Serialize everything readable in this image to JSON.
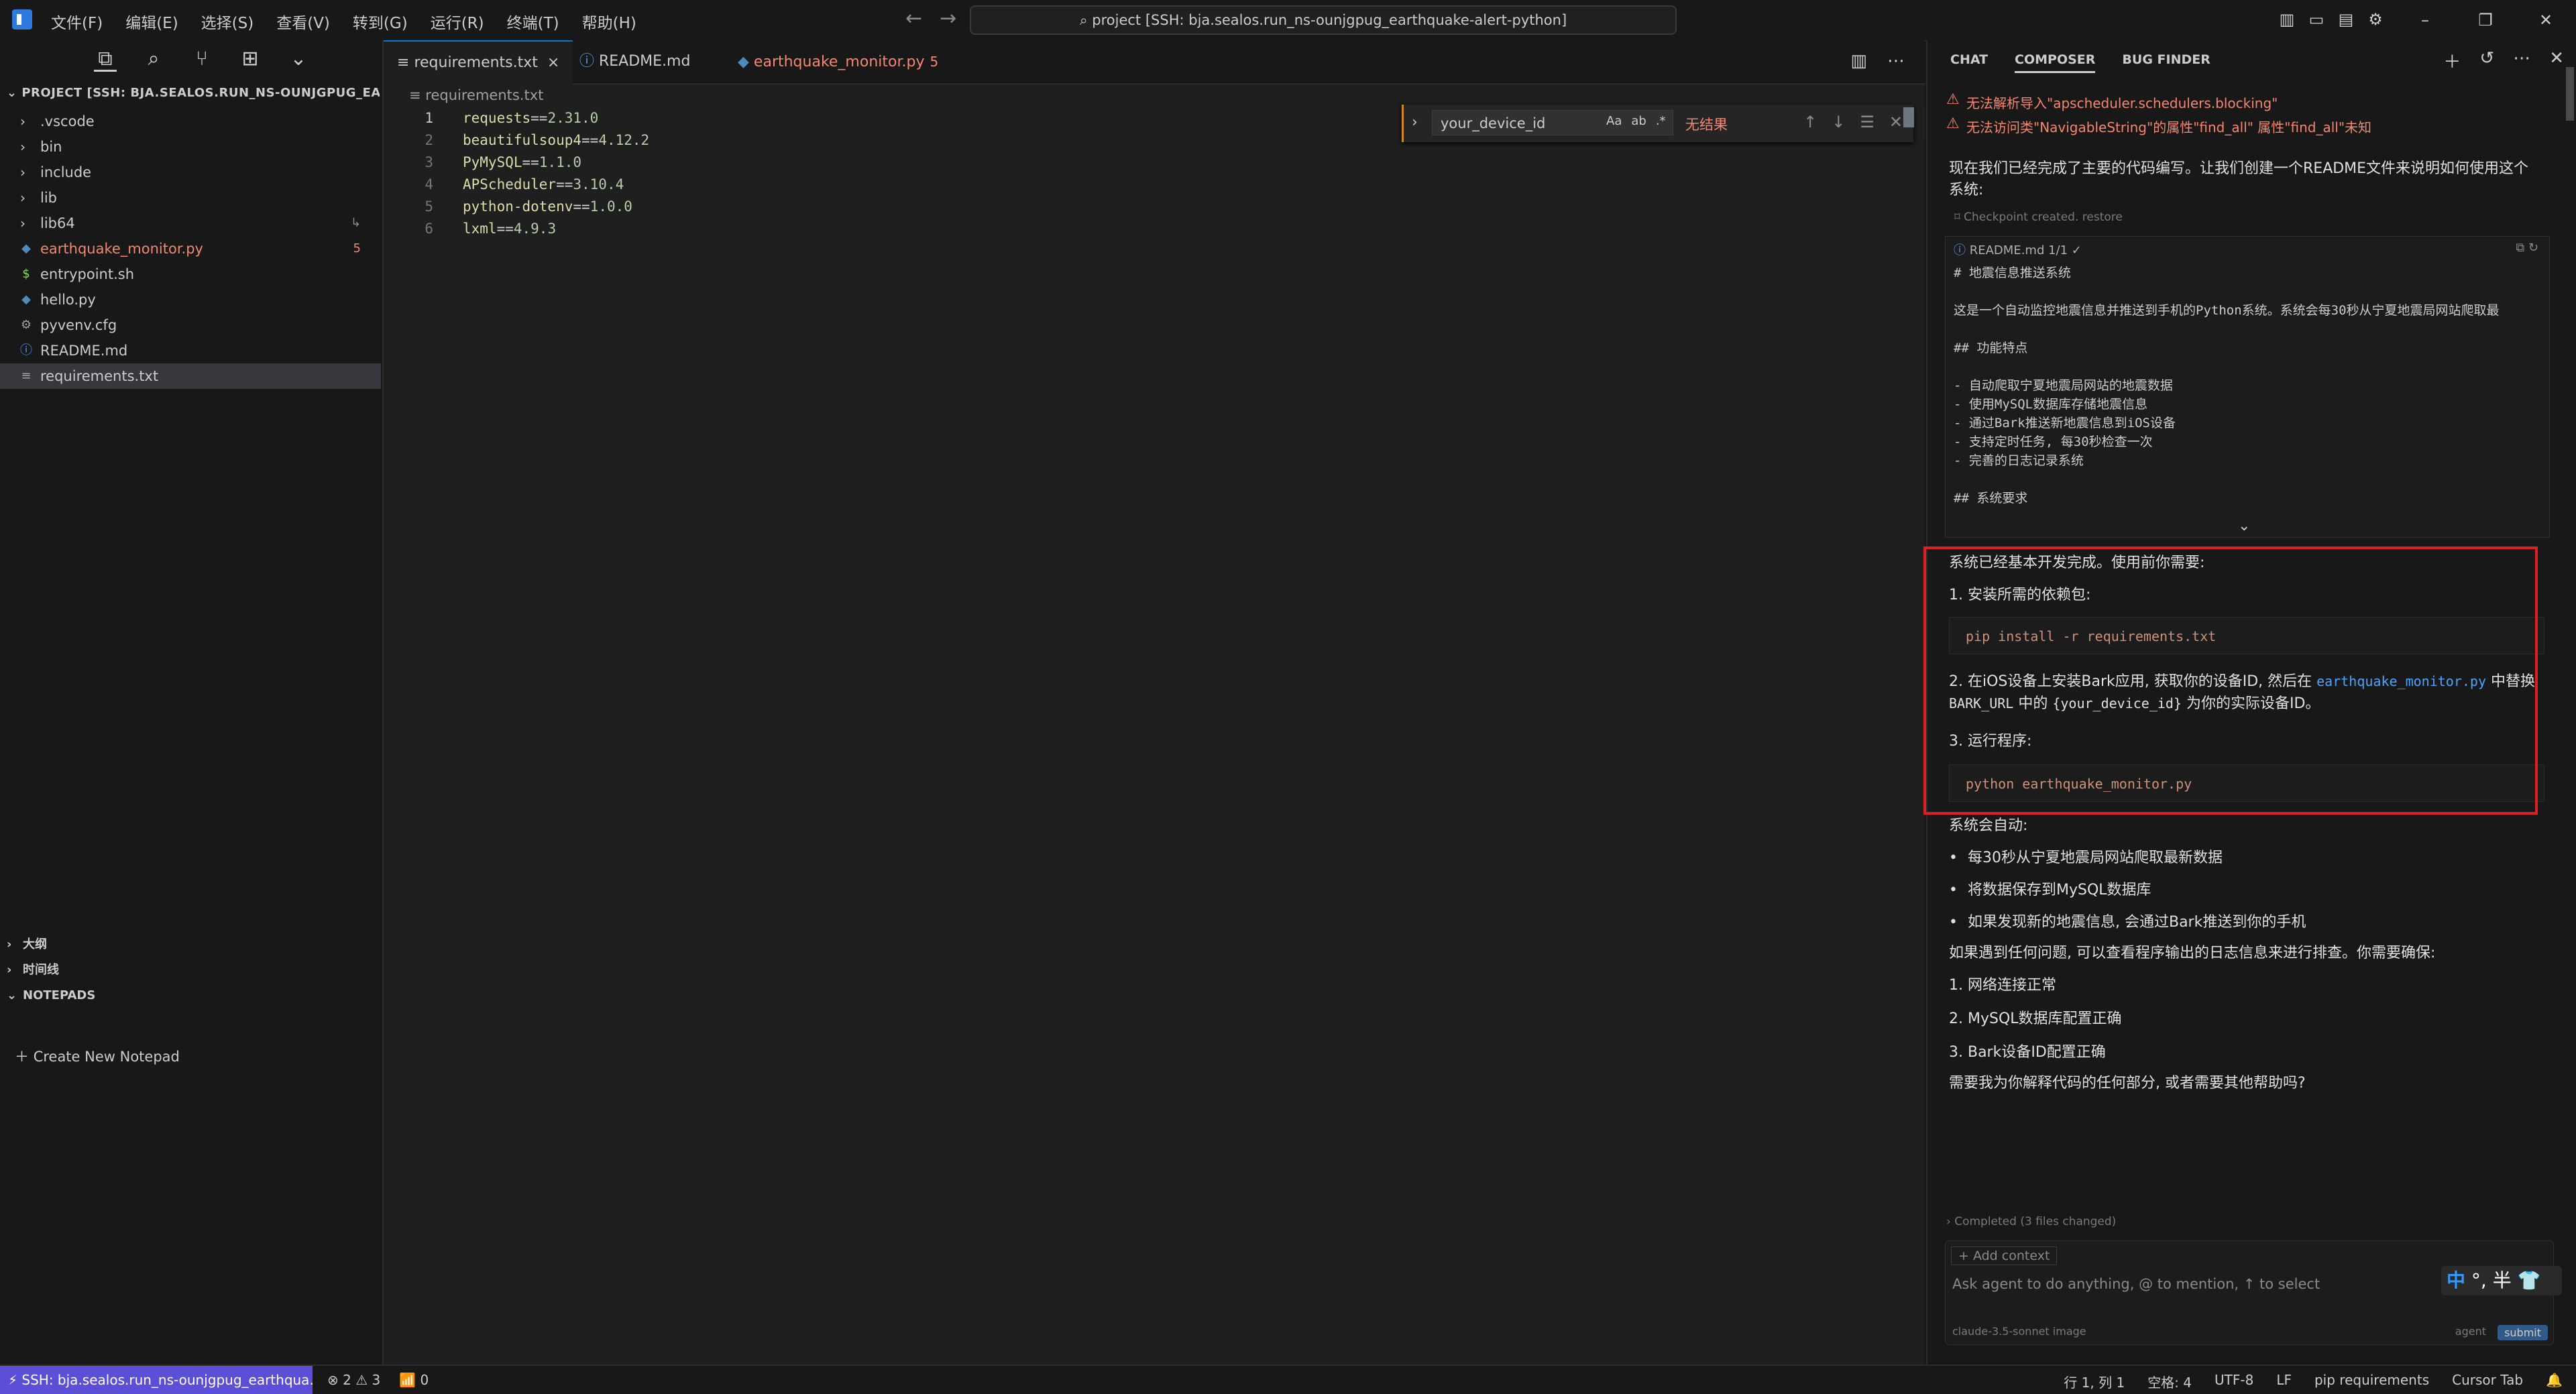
{
  "menu": [
    "文件(F)",
    "编辑(E)",
    "选择(S)",
    "查看(V)",
    "转到(G)",
    "运行(R)",
    "终端(T)",
    "帮助(H)"
  ],
  "command_center": "project [SSH: bja.sealos.run_ns-ounjgpug_earthquake-alert-python]",
  "sidebar": {
    "project_header": "PROJECT [SSH: BJA.SEALOS.RUN_NS-OUNJGPUG_EARTH...",
    "items": [
      {
        "label": ".vscode",
        "type": "folder"
      },
      {
        "label": "bin",
        "type": "folder"
      },
      {
        "label": "include",
        "type": "folder"
      },
      {
        "label": "lib",
        "type": "folder"
      },
      {
        "label": "lib64",
        "type": "folder"
      },
      {
        "label": "earthquake_monitor.py",
        "type": "file",
        "badge": "5"
      },
      {
        "label": "entrypoint.sh",
        "type": "file"
      },
      {
        "label": "hello.py",
        "type": "file"
      },
      {
        "label": "pyvenv.cfg",
        "type": "file"
      },
      {
        "label": "README.md",
        "type": "file"
      },
      {
        "label": "requirements.txt",
        "type": "file"
      }
    ],
    "outline": "大纲",
    "timeline": "时间线",
    "notepads": "NOTEPADS",
    "create_notepad": "Create New Notepad"
  },
  "editor": {
    "tabs": [
      {
        "label": "requirements.txt",
        "close": "×"
      },
      {
        "label": "README.md"
      },
      {
        "label": "earthquake_monitor.py",
        "count": "5"
      }
    ],
    "breadcrumb": "requirements.txt",
    "lines": [
      {
        "num": "1",
        "pkg": "requests",
        "ver": "2.31.0"
      },
      {
        "num": "2",
        "pkg": "beautifulsoup4",
        "ver": "4.12.2"
      },
      {
        "num": "3",
        "pkg": "PyMySQL",
        "ver": "1.1.0"
      },
      {
        "num": "4",
        "pkg": "APScheduler",
        "ver": "3.10.4"
      },
      {
        "num": "5",
        "pkg": "python-dotenv",
        "ver": "1.0.0"
      },
      {
        "num": "6",
        "pkg": "lxml",
        "ver": "4.9.3"
      }
    ],
    "find": {
      "value": "your_device_id",
      "opt1": "Aa",
      "opt2": "ab",
      "opt3": ".*",
      "result": "无结果"
    }
  },
  "panel": {
    "tabs": [
      "CHAT",
      "COMPOSER",
      "BUG FINDER"
    ],
    "warnings": [
      "无法解析导入\"apscheduler.schedulers.blocking\"",
      "无法访问类\"NavigableString\"的属性\"find_all\"  属性\"find_all\"未知"
    ],
    "intro": "现在我们已经完成了主要的代码编写。让我们创建一个README文件来说明如何使用这个系统:",
    "checkpoint": "Checkpoint created. restore",
    "filecard": {
      "name": "README.md",
      "count": "1/1 ✓",
      "body": "# 地震信息推送系统\n\n这是一个自动监控地震信息并推送到手机的Python系统。系统会每30秒从宁夏地震局网站爬取最\n\n## 功能特点\n\n- 自动爬取宁夏地震局网站的地震数据\n- 使用MySQL数据库存储地震信息\n- 通过Bark推送新地震信息到iOS设备\n- 支持定时任务, 每30秒检查一次\n- 完善的日志记录系统\n\n## 系统要求"
    },
    "done": "系统已经基本开发完成。使用前你需要:",
    "step1": "1. 安装所需的依赖包:",
    "cmd1": "pip install -r requirements.txt",
    "step2_a": "2. 在iOS设备上安装Bark应用, 获取你的设备ID, 然后在",
    "step2_link": "earthquake_monitor.py",
    "step2_b": "中替换",
    "step2_c1": "BARK_URL",
    "step2_c2": "中的",
    "step2_c3": "{your_device_id}",
    "step2_c4": "为你的实际设备ID。",
    "step3": "3. 运行程序:",
    "cmd2": "python earthquake_monitor.py",
    "auto": "系统会自动:",
    "bullets": [
      "每30秒从宁夏地震局网站爬取最新数据",
      "将数据保存到MySQL数据库",
      "如果发现新的地震信息, 会通过Bark推送到你的手机"
    ],
    "trouble": "如果遇到任何问题, 可以查看程序输出的日志信息来进行排查。你需要确保:",
    "checks": [
      "1. 网络连接正常",
      "2. MySQL数据库配置正确",
      "3. Bark设备ID配置正确"
    ],
    "ask": "需要我为你解释代码的任何部分, 或者需要其他帮助吗?",
    "completed": "Completed (3 files changed)",
    "add_context": "+ Add context",
    "placeholder": "Ask agent to do anything, @ to mention, ↑ to select",
    "model": "claude-3.5-sonnet  image",
    "agent": "agent",
    "submit": "submit"
  },
  "ime": {
    "zh": "中",
    "rest": "°, 半"
  },
  "status": {
    "remote": "SSH: bja.sealos.run_ns-ounjgpug_earthqua...",
    "problems": "⊗ 2 ⚠ 3",
    "ports": "0",
    "position": "行 1, 列 1",
    "spaces": "空格: 4",
    "encoding": "UTF-8",
    "eol": "LF",
    "lang": "pip requirements",
    "cursor_tab": "Cursor Tab"
  }
}
